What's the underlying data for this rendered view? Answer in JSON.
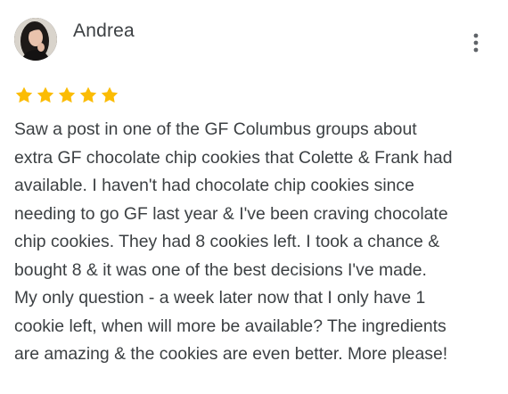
{
  "reviewer": {
    "name": "Andrea",
    "avatar_icon": "profile-photo"
  },
  "menu": {
    "icon": "more-vertical-icon"
  },
  "rating": {
    "stars": 5,
    "max": 5,
    "color": "#fbbc04"
  },
  "review": {
    "text": "Saw a post in one of the GF Columbus groups about\nextra GF chocolate chip cookies that Colette & Frank had\navailable. I haven't had chocolate chip cookies since\nneeding to go GF last year & I've been craving chocolate\nchip cookies. They had 8 cookies left. I took a chance &\nbought 8 & it was one of the best decisions I've made.\nMy only question - a week later now that I only have 1\ncookie left, when will more be available? The ingredients\nare amazing & the cookies are even better. More please!"
  },
  "colors": {
    "text": "#3c4043",
    "icon": "#5f6368",
    "star": "#fbbc04"
  }
}
